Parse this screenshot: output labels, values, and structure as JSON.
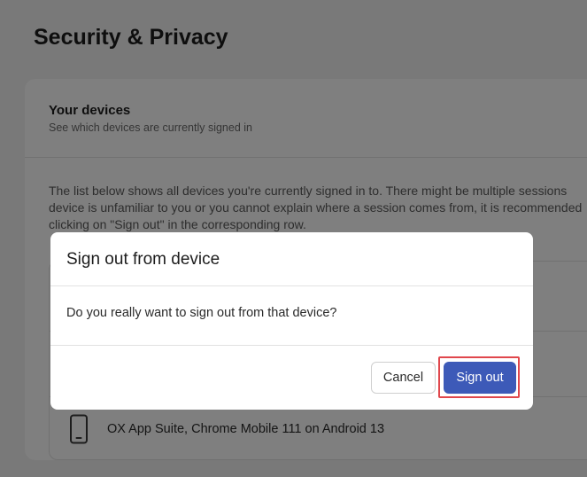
{
  "page": {
    "title": "Security & Privacy"
  },
  "card": {
    "title": "Your devices",
    "subtitle": "See which devices are currently signed in",
    "description_lines": [
      "The list below shows all devices you're currently signed in to. There might be multiple sessions",
      "device is unfamiliar to you or you cannot explain where a session comes from, it is recommended",
      "clicking on \"Sign out\" in the corresponding row."
    ]
  },
  "devices": [
    {
      "name": ""
    },
    {
      "name": ""
    },
    {
      "name": "OX App Suite, Chrome Mobile 111 on Android 13",
      "icon": "mobile-phone-icon"
    }
  ],
  "dialog": {
    "title": "Sign out from device",
    "message": "Do you really want to sign out from that device?",
    "cancel_label": "Cancel",
    "confirm_label": "Sign out"
  },
  "colors": {
    "primary": "#3d5ab8",
    "highlight": "#e0474c",
    "overlay": "rgba(0,0,0,0.5)"
  }
}
